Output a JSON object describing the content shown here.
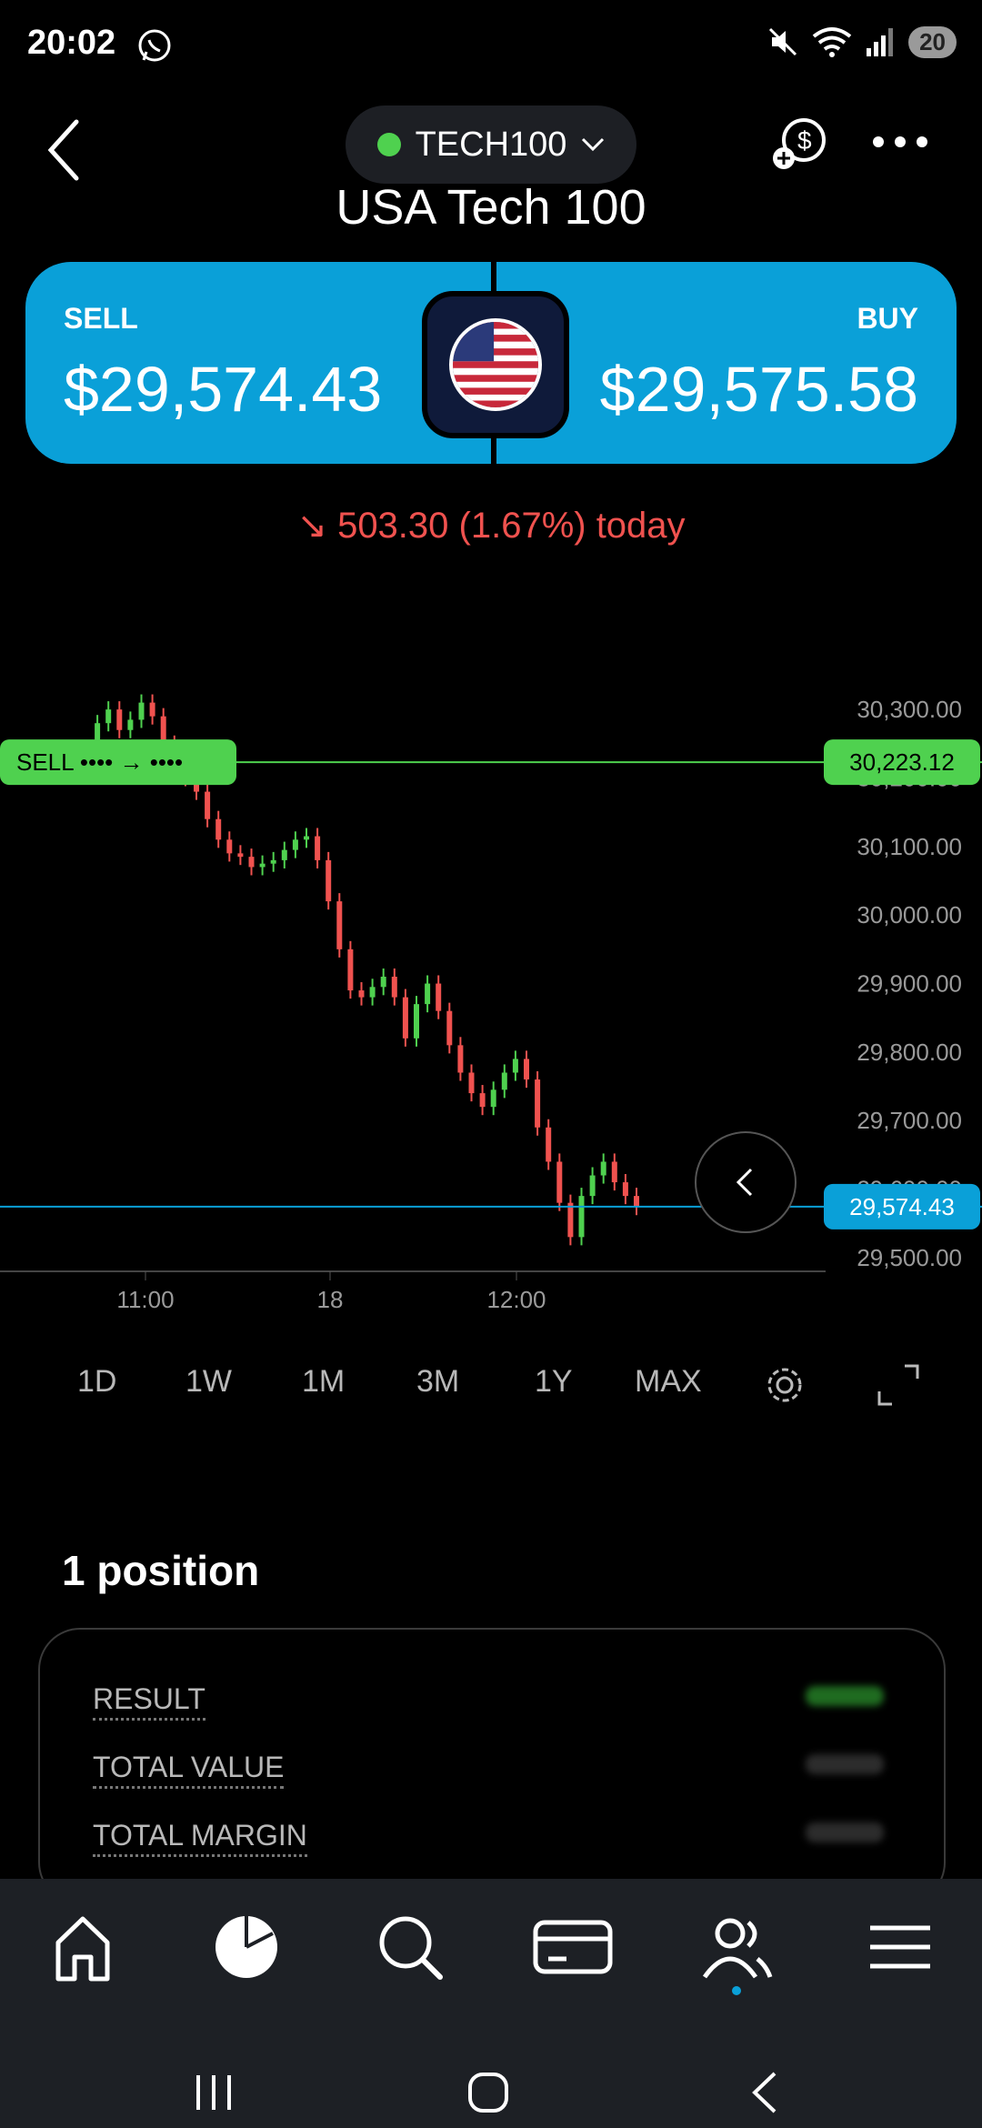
{
  "status_bar": {
    "time": "20:02",
    "battery": "20",
    "network": "6"
  },
  "header": {
    "symbol": "TECH100",
    "title": "USA Tech 100"
  },
  "price": {
    "sell_label": "SELL",
    "sell_value": "$29,574.43",
    "buy_label": "BUY",
    "buy_value": "$29,575.58"
  },
  "change": {
    "text": "↘ 503.30 (1.67%) today"
  },
  "chart": {
    "y_ticks": [
      "30,300.00",
      "30,200.00",
      "30,100.00",
      "30,000.00",
      "29,900.00",
      "29,800.00",
      "29,700.00",
      "29,600.00",
      "29,500.00"
    ],
    "x_ticks": [
      "11:00",
      "18",
      "12:00"
    ],
    "sell_order_label": "SELL •••• → ••••",
    "sell_order_price": "30,223.12",
    "current_price": "29,574.43"
  },
  "chart_data": {
    "type": "line",
    "title": "",
    "ylim": [
      29480,
      30340
    ],
    "x_ticks": [
      "11:00",
      "18",
      "12:00"
    ],
    "series": [
      {
        "values": [
          30240,
          30280,
          30300,
          30270,
          30285,
          30310,
          30290,
          30250,
          30220,
          30200,
          30180,
          30140,
          30110,
          30090,
          30085,
          30070,
          30075,
          30080,
          30095,
          30110,
          30115,
          30080,
          30020,
          29950,
          29890,
          29880,
          29895,
          29910,
          29880,
          29820,
          29870,
          29900,
          29860,
          29810,
          29770,
          29740,
          29720,
          29745,
          29770,
          29790,
          29760,
          29690,
          29640,
          29580,
          29530,
          29590,
          29620,
          29640,
          29610,
          29590,
          29574
        ]
      }
    ],
    "horizontal_lines": [
      {
        "label": "SELL",
        "value": 30223.12
      },
      {
        "label": "current",
        "value": 29574.43
      }
    ],
    "colors": {
      "up": "#4fd14f",
      "down": "#f0524f",
      "sell_line": "#4fd14f",
      "price_line": "#0aa0d8"
    }
  },
  "timeframes": [
    "1D",
    "1W",
    "1M",
    "3M",
    "1Y",
    "MAX"
  ],
  "positions": {
    "title": "1 position",
    "rows": [
      {
        "label": "RESULT"
      },
      {
        "label": "TOTAL VALUE"
      },
      {
        "label": "TOTAL MARGIN"
      }
    ]
  },
  "nav": {
    "items": [
      "home-icon",
      "pie-chart-icon",
      "search-icon",
      "card-icon",
      "people-icon",
      "menu-icon"
    ]
  }
}
